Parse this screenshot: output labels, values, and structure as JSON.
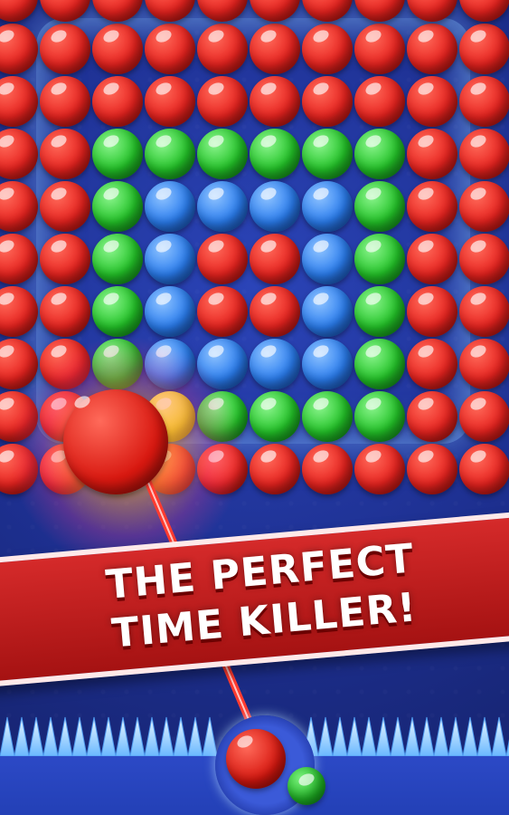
{
  "game": {
    "banner_line1": "THE PERFECT",
    "banner_line2": "TIME KILLER!"
  },
  "colors": {
    "red": "#e8231f",
    "green": "#23c428",
    "blue": "#2b7ef0",
    "yellow": "#f0e01c",
    "banner": "#c41f1f"
  },
  "board": {
    "rows": [
      [
        "red",
        "red",
        "red",
        "red",
        "red",
        "red",
        "red",
        "red",
        "red",
        "red"
      ],
      [
        "red",
        "red",
        "red",
        "red",
        "red",
        "red",
        "red",
        "red",
        "red",
        "red"
      ],
      [
        "red",
        "red",
        "green",
        "green",
        "green",
        "green",
        "green",
        "green",
        "red",
        "red"
      ],
      [
        "red",
        "red",
        "green",
        "blue",
        "blue",
        "blue",
        "blue",
        "green",
        "red",
        "red"
      ],
      [
        "red",
        "red",
        "green",
        "blue",
        "red",
        "red",
        "blue",
        "green",
        "red",
        "red"
      ],
      [
        "red",
        "red",
        "green",
        "blue",
        "red",
        "red",
        "blue",
        "green",
        "red",
        "red"
      ],
      [
        "red",
        "red",
        "green",
        "blue",
        "blue",
        "blue",
        "blue",
        "green",
        "red",
        "red"
      ],
      [
        "red",
        "red",
        "yellow",
        "yellow",
        "green",
        "green",
        "green",
        "green",
        "red",
        "red"
      ],
      [
        "red",
        "red",
        "red",
        "red",
        "red",
        "red",
        "red",
        "red",
        "red",
        "red"
      ]
    ]
  },
  "shooter": {
    "current": "red",
    "next": "green"
  }
}
